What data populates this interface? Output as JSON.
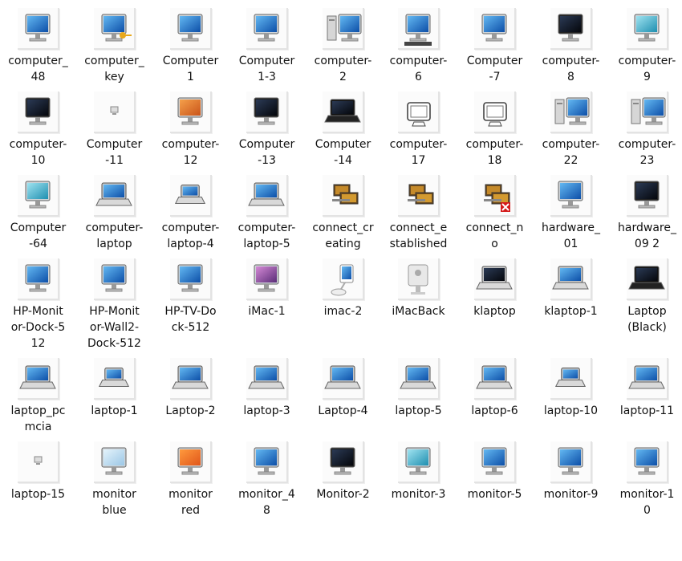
{
  "colors": {
    "background": "#ffffff",
    "label_text": "#111111",
    "tile_shadow": "#e3e3e3"
  },
  "icons": [
    {
      "label": "computer_\n48",
      "icon": "crt-monitor-icon"
    },
    {
      "label": "computer_\nkey",
      "icon": "computer-key-icon"
    },
    {
      "label": "Computer\n1",
      "icon": "desktop-blue-icon"
    },
    {
      "label": "Computer\n1-3",
      "icon": "desktop-blue-small-icon"
    },
    {
      "label": "computer-\n2",
      "icon": "tower-monitor-icon"
    },
    {
      "label": "computer-\n6",
      "icon": "monitor-keyboard-icon"
    },
    {
      "label": "Computer\n-7",
      "icon": "flat-monitor-blue-icon"
    },
    {
      "label": "computer-\n8",
      "icon": "monitor-dark-icon"
    },
    {
      "label": "computer-\n9",
      "icon": "monitor-teal-icon"
    },
    {
      "label": "computer-\n10",
      "icon": "imac-black-icon"
    },
    {
      "label": "Computer\n-11",
      "icon": "tiny-computer-icon"
    },
    {
      "label": "computer-\n12",
      "icon": "monitor-orange-icon"
    },
    {
      "label": "Computer\n-13",
      "icon": "monitor-navy-icon"
    },
    {
      "label": "Computer\n-14",
      "icon": "laptop-black-outline-icon"
    },
    {
      "label": "computer-\n17",
      "icon": "sketch-computer-icon"
    },
    {
      "label": "computer-\n18",
      "icon": "sketch-monitor-icon"
    },
    {
      "label": "computer-\n22",
      "icon": "tower-small-monitor-icon"
    },
    {
      "label": "computer-\n23",
      "icon": "tower-large-monitor-icon"
    },
    {
      "label": "Computer\n-64",
      "icon": "crt-aqua-icon"
    },
    {
      "label": "computer-\nlaptop",
      "icon": "laptop-blue-icon"
    },
    {
      "label": "computer-\nlaptop-4",
      "icon": "laptop-small-icon"
    },
    {
      "label": "computer-\nlaptop-5",
      "icon": "laptop-large-icon"
    },
    {
      "label": "connect_cr\neating",
      "icon": "network-connect-icon"
    },
    {
      "label": "connect_e\nstablished",
      "icon": "network-established-icon"
    },
    {
      "label": "connect_n\no",
      "icon": "network-error-icon"
    },
    {
      "label": "hardware_\n01",
      "icon": "monitor-blue-glossy-icon"
    },
    {
      "label": "hardware_\n09 2",
      "icon": "monitor-black-glossy-icon"
    },
    {
      "label": "HP-Monit\nor-Dock-5\n12",
      "icon": "hp-monitor-icon"
    },
    {
      "label": "HP-Monit\nor-Wall2-\nDock-512",
      "icon": "hp-monitor-wall-icon"
    },
    {
      "label": "HP-TV-Do\nck-512",
      "icon": "hp-tv-icon"
    },
    {
      "label": "iMac-1",
      "icon": "imac-purple-icon"
    },
    {
      "label": "imac-2",
      "icon": "imac-g4-icon"
    },
    {
      "label": "iMacBack",
      "icon": "imac-back-icon"
    },
    {
      "label": "klaptop",
      "icon": "laptop-dark-icon"
    },
    {
      "label": "klaptop-1",
      "icon": "laptop-white-icon"
    },
    {
      "label": "Laptop\n(Black)",
      "icon": "laptop-black-icon"
    },
    {
      "label": "laptop_pc\nmcia",
      "icon": "laptop-tilted-icon"
    },
    {
      "label": "laptop-1",
      "icon": "laptop-side-icon"
    },
    {
      "label": "Laptop-2",
      "icon": "laptop-flat-icon"
    },
    {
      "label": "laptop-3",
      "icon": "laptop-silver-icon"
    },
    {
      "label": "Laptop-4",
      "icon": "laptop-open-icon"
    },
    {
      "label": "laptop-5",
      "icon": "laptop-glossy-icon"
    },
    {
      "label": "laptop-6",
      "icon": "laptop-grey-icon"
    },
    {
      "label": "laptop-10",
      "icon": "laptop-mini-icon"
    },
    {
      "label": "laptop-11",
      "icon": "laptop-desktop-icon"
    },
    {
      "label": "laptop-15",
      "icon": "laptop-tiny-icon"
    },
    {
      "label": "monitor\nblue",
      "icon": "monitor-light-blue-icon"
    },
    {
      "label": "monitor\nred",
      "icon": "monitor-red-icon"
    },
    {
      "label": "monitor_4\n8",
      "icon": "monitor-silver-icon"
    },
    {
      "label": "Monitor-2",
      "icon": "monitor-black-icon"
    },
    {
      "label": "monitor-3",
      "icon": "monitor-aqua-icon"
    },
    {
      "label": "monitor-5",
      "icon": "monitor-striped-icon"
    },
    {
      "label": "monitor-9",
      "icon": "monitor-small-icon"
    },
    {
      "label": "monitor-1\n0",
      "icon": "monitor-wide-icon"
    }
  ]
}
